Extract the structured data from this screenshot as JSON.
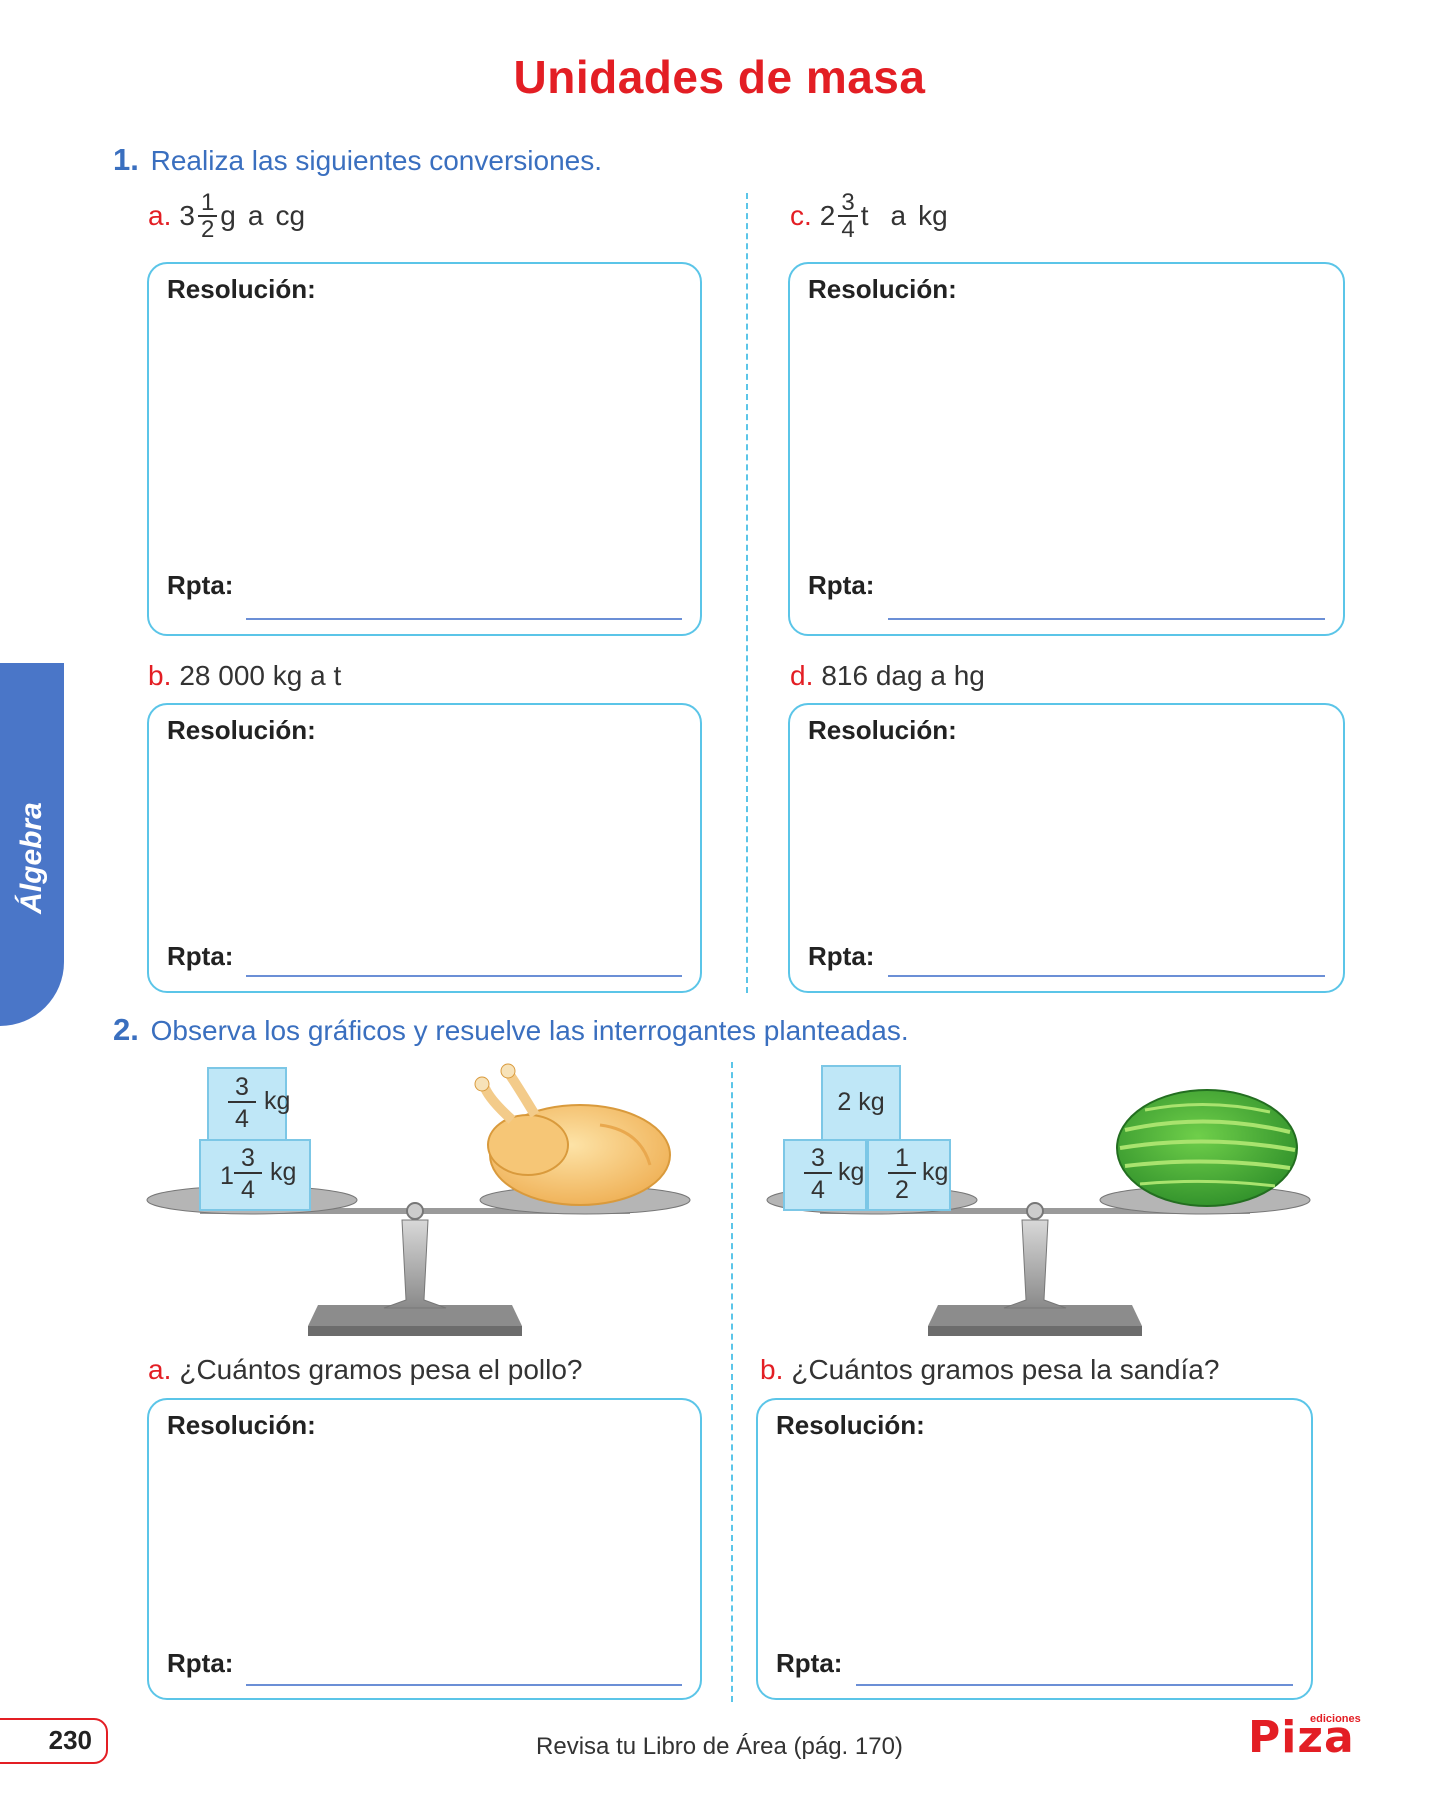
{
  "title": "Unidades de masa",
  "side_tab": "Álgebra",
  "section1": {
    "number": "1.",
    "instruction": "Realiza las siguientes conversiones.",
    "a": {
      "letter": "a.",
      "whole": "3",
      "num": "1",
      "den": "2",
      "rest_unit": "g",
      "rest_a": "a",
      "rest_target": "cg"
    },
    "c": {
      "letter": "c.",
      "whole": "2",
      "num": "3",
      "den": "4",
      "rest_unit": "t",
      "rest_a": "a",
      "rest_target": "kg"
    },
    "b": {
      "letter": "b.",
      "text": "28 000 kg a t"
    },
    "d": {
      "letter": "d.",
      "text": "816 dag a hg"
    }
  },
  "section2": {
    "number": "2.",
    "instruction": "Observa los gráficos y resuelve las interrogantes planteadas.",
    "scale_left": {
      "top_block": {
        "num": "3",
        "den": "4",
        "unit": "kg"
      },
      "bottom_block": {
        "whole": "1",
        "num": "3",
        "den": "4",
        "unit": "kg"
      }
    },
    "scale_right": {
      "top_block": {
        "text": "2 kg"
      },
      "left_block": {
        "num": "3",
        "den": "4",
        "unit": "kg"
      },
      "right_block": {
        "num": "1",
        "den": "2",
        "unit": "kg"
      }
    },
    "a": {
      "letter": "a.",
      "question": "¿Cuántos gramos pesa el pollo?"
    },
    "b": {
      "letter": "b.",
      "question": "¿Cuántos gramos pesa la sandía?"
    }
  },
  "labels": {
    "resolucion": "Resolución:",
    "rpta": "Rpta:"
  },
  "footer": {
    "page_number": "230",
    "text": "Revisa tu Libro de Área (pág. 170)",
    "logo_small": "ediciones",
    "logo_big": "Piza"
  },
  "colors": {
    "title_red": "#e31e24",
    "heading_blue": "#3a6fbf",
    "box_border": "#5bc5e8",
    "tab_blue": "#4a76c8"
  }
}
